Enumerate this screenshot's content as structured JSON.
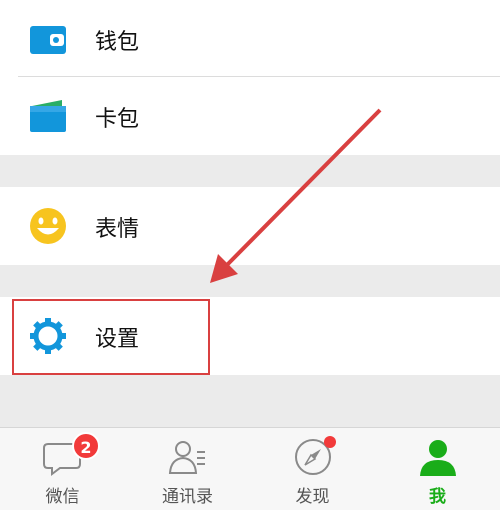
{
  "menu": {
    "wallet_label": "钱包",
    "cards_label": "卡包",
    "stickers_label": "表情",
    "settings_label": "设置"
  },
  "tabbar": {
    "chats_label": "微信",
    "chats_badge": "2",
    "contacts_label": "通讯录",
    "discover_label": "发现",
    "me_label": "我"
  },
  "colors": {
    "accent_green": "#1aad19",
    "icon_blue": "#1296db",
    "badge_red": "#f23a3a",
    "annotation_red": "#d94040"
  },
  "icons": [
    "wallet-icon",
    "card-pack-icon",
    "sticker-smiley-icon",
    "settings-gear-icon",
    "chat-bubble-icon",
    "contacts-icon",
    "compass-icon",
    "me-person-icon"
  ]
}
